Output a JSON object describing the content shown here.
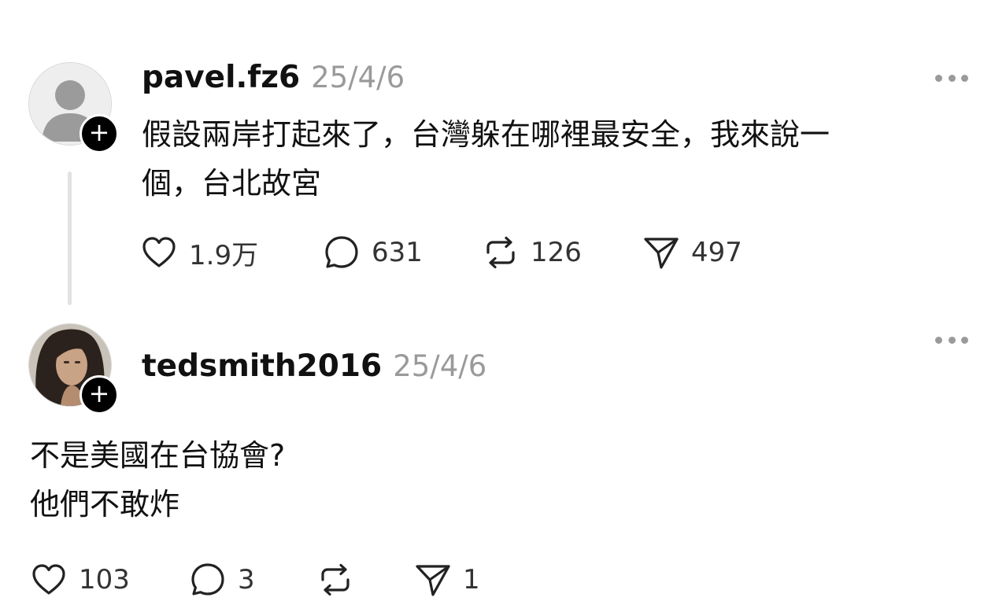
{
  "posts": [
    {
      "username": "pavel.fz6",
      "time": "25/4/6",
      "text_lines": [
        "假設兩岸打起來了，台灣躲在哪裡最安全，我來說一",
        "個，台北故宮"
      ],
      "likes": "1.9万",
      "replies": "631",
      "reposts": "126",
      "shares": "497"
    },
    {
      "username": "tedsmith2016",
      "time": "25/4/6",
      "text_lines": [
        "不是美國在台協會?",
        "他們不敢炸"
      ],
      "likes": "103",
      "replies": "3",
      "reposts": "",
      "shares": "1"
    }
  ],
  "icons": {
    "follow": "plus-icon",
    "more": "more-dots-icon",
    "like": "heart-icon",
    "reply": "speech-bubble-icon",
    "repost": "repost-arrows-icon",
    "share": "paper-plane-icon"
  },
  "colors": {
    "text": "#111111",
    "muted": "#9a9a9a",
    "badge": "#000000"
  },
  "badge_symbol": "+"
}
